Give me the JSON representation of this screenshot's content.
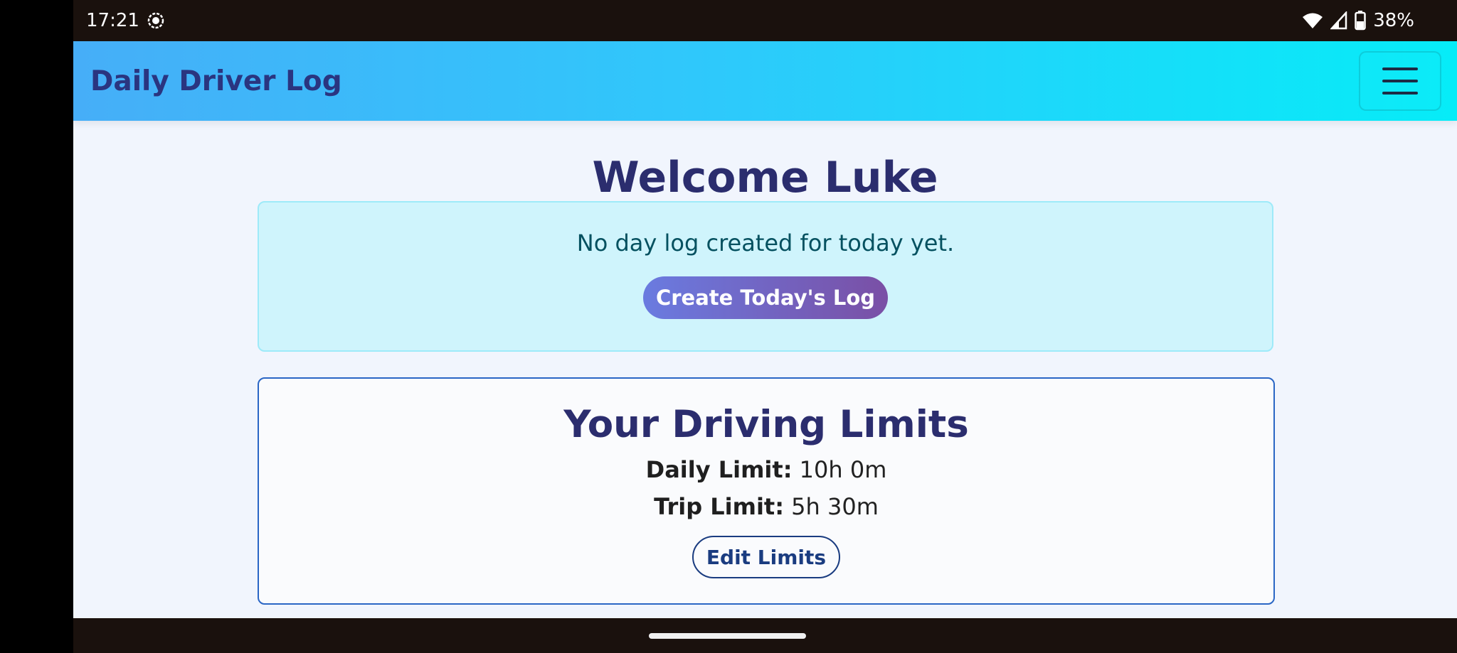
{
  "status_bar": {
    "time": "17:21",
    "battery_percent": "38%",
    "icons": [
      "screen-record-icon",
      "wifi-icon",
      "signal-icon",
      "battery-icon"
    ]
  },
  "navbar": {
    "brand": "Daily Driver Log",
    "menu_icon": "hamburger-menu-icon"
  },
  "welcome": {
    "title": "Welcome Luke"
  },
  "alert": {
    "text": "No day log created for today yet.",
    "button_label": "Create Today's Log"
  },
  "limits": {
    "title": "Your Driving Limits",
    "daily_label": "Daily Limit:",
    "daily_value": "10h 0m",
    "trip_label": "Trip Limit:",
    "trip_value": "5h 30m",
    "edit_label": "Edit Limits"
  },
  "colors": {
    "navbar_gradient_start": "#46aef8",
    "navbar_gradient_end": "#06ecf8",
    "heading": "#2b2d6e",
    "alert_bg": "#cff4fc",
    "button_gradient_start": "#6a7be0",
    "button_gradient_end": "#7a4fa5"
  }
}
